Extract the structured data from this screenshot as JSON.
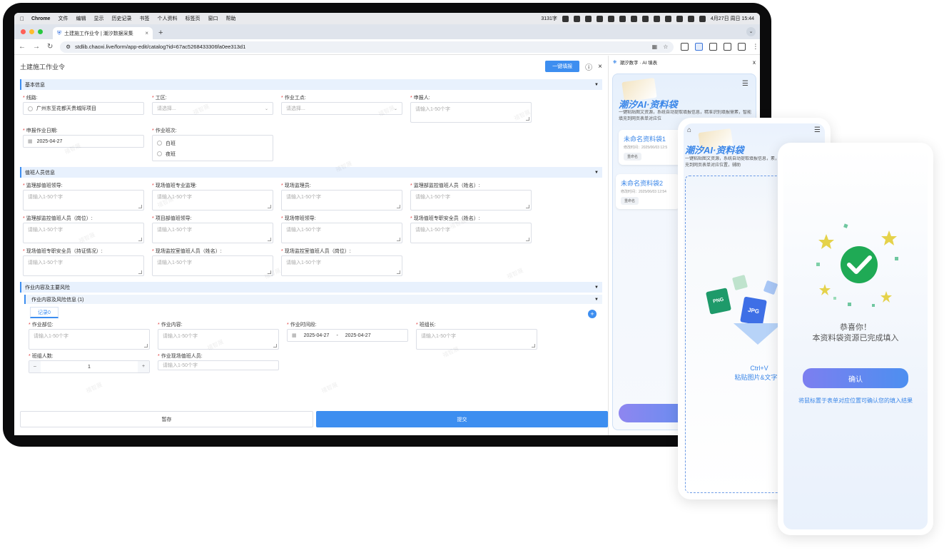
{
  "menubar": {
    "apple": "",
    "items": [
      "Chrome",
      "文件",
      "编辑",
      "显示",
      "历史记录",
      "书签",
      "个人资料",
      "标签页",
      "窗口",
      "帮助"
    ],
    "status_count": "3131字",
    "datetime": "4月27日 周日  15:44"
  },
  "browser": {
    "tab_title": "土建施工作业令 | 潮汐数据采集",
    "url": "stdlib.chaoxi.live/form/app-edit/catalog?id=67ac5268433306fa0ee313d1"
  },
  "form": {
    "title": "土建施工作业令",
    "fill_button": "一键填报",
    "watermark": "禧智展",
    "sections": {
      "basic": "基本信息",
      "duty": "值班人员信息",
      "work": "作业内容及主要风险",
      "work_sub": "作业内容及风险信息 (1)"
    },
    "basic": {
      "line_label": "线路:",
      "line_value": "广州东至花都天贵城际项目",
      "area_label": "工区:",
      "area_placeholder": "请选择...",
      "site_label": "作业工点:",
      "site_placeholder": "请选择...",
      "applicant_label": "申报人:",
      "date_label": "申报作业日期:",
      "date_value": "2025-04-27",
      "shift_label": "作业班次:",
      "shift_day": "白班",
      "shift_night": "夜班"
    },
    "placeholder": "请输入1-50个字",
    "duty_fields": [
      {
        "label": "监理部值班领导:",
        "req": true
      },
      {
        "label": "现场值班专业监理:",
        "req": true
      },
      {
        "label": "现场监理员:",
        "req": true
      },
      {
        "label": "监理部监控值班人员（姓名）:",
        "req": true
      },
      {
        "label": "监理部监控值班人员（岗位）:",
        "req": true
      },
      {
        "label": "项目部值班领导:",
        "req": true
      },
      {
        "label": "现场带班领导:",
        "req": true
      },
      {
        "label": "现场值班专职安全员（姓名）:",
        "req": true
      },
      {
        "label": "现场值班专职安全员（持证情况）:",
        "req": true
      },
      {
        "label": "现场监控室值班人员（姓名）:",
        "req": true
      },
      {
        "label": "现场监控室值班人员（岗位）:",
        "req": true
      }
    ],
    "record_tab": "记录0",
    "work": {
      "part_label": "作业部位:",
      "content_label": "作业内容:",
      "time_label": "作业时间段:",
      "time_start": "2025-04-27",
      "time_sep": "-",
      "time_end": "2025-04-27",
      "leader_label": "班组长:",
      "count_label": "班组人数:",
      "count_value": "1",
      "minus": "–",
      "plus": "+",
      "staff_label": "作业现场值班人员:"
    },
    "save_button": "暂存",
    "submit_button": "提交"
  },
  "sidepane": {
    "header": "潮汐数字 · AI 填表",
    "brand": "潮汐AI·资料袋",
    "desc": "一键粘贴图文资源，系统自动提取填报信息，精准识别填报需素，智能填充到网页表单对应位",
    "bags": [
      {
        "title": "未命名资料袋1",
        "time": "修改时间：2025/06/03 12:5",
        "btn": "重命名"
      },
      {
        "title": "未命名资料袋2",
        "time": "修改时间：2025/06/03 12:54",
        "btn": "重命名"
      }
    ]
  },
  "phone_a": {
    "brand": "潮汐AI·资料袋",
    "desc": "一键粘贴图文资源，系统自动提取填报信息，素，智能填充到网页表单对应位置，辅助",
    "file_png": "PNG",
    "file_jpg": "JPG",
    "drop_line1": "Ctrl+V",
    "drop_line2": "粘贴图片&文字资"
  },
  "phone_b": {
    "congrats_line1": "恭喜你！",
    "congrats_line2": "本资料袋资源已完成填入",
    "confirm": "确认",
    "hint": "将鼠标置于表单对应位置可确认您的填入结果"
  },
  "colors": {
    "accent": "#3d8ef0",
    "success": "#1faa55",
    "required": "#e23b3b"
  }
}
